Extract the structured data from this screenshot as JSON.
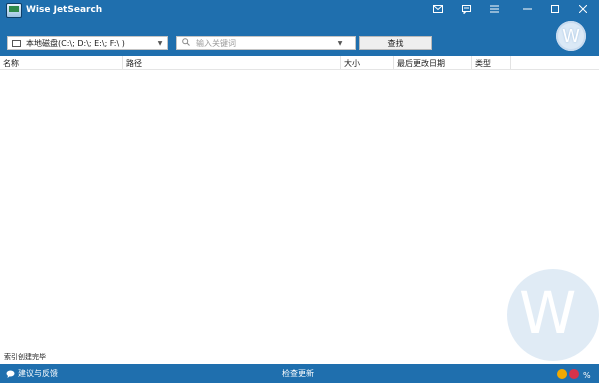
{
  "window": {
    "title": "Wise JetSearch",
    "controls": [
      "mail-icon",
      "feedback-icon",
      "menu-icon",
      "minimize-icon",
      "maximize-icon",
      "close-icon"
    ]
  },
  "avatar": {
    "letter": "W"
  },
  "toolbar": {
    "drive_select_value": "本地磁盘(C:\\; D:\\; E:\\; F:\\ )",
    "search_placeholder": "输入关键词",
    "find_label": "查找"
  },
  "columns": [
    {
      "label": "名称"
    },
    {
      "label": "路径"
    },
    {
      "label": "大小"
    },
    {
      "label": "最后更改日期"
    },
    {
      "label": "类型"
    }
  ],
  "status": {
    "text": "索引创建完毕"
  },
  "footer": {
    "feedback_label": "建议与反馈",
    "update_label": "检查更新",
    "badges": [
      "coin-icon",
      "notification-icon",
      "language-icon"
    ]
  },
  "watermark": {
    "letter": "W"
  }
}
